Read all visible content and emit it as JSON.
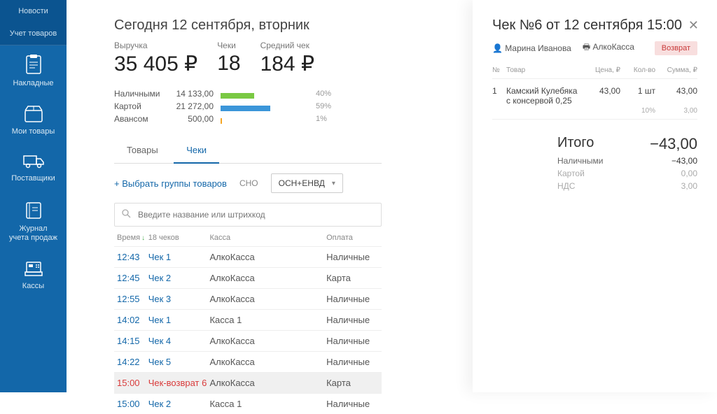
{
  "sidebar": {
    "top_links": [
      "Новости",
      "Учет товаров"
    ],
    "items": [
      {
        "label": "Накладные"
      },
      {
        "label": "Мои товары"
      },
      {
        "label": "Поставщики"
      },
      {
        "label": "Журнал\nучета продаж"
      },
      {
        "label": "Кассы"
      }
    ]
  },
  "date_title": "Сегодня 12 сентября, вторник",
  "metrics": {
    "revenue": {
      "label": "Выручка",
      "value": "35 405 ₽"
    },
    "checks": {
      "label": "Чеки",
      "value": "18"
    },
    "avg": {
      "label": "Средний чек",
      "value": "184 ₽"
    }
  },
  "payments": [
    {
      "label": "Наличными",
      "amount": "14 133,00",
      "pct": "40%",
      "color": "#7ac943",
      "width": 40
    },
    {
      "label": "Картой",
      "amount": "21 272,00",
      "pct": "59%",
      "color": "#3b96d9",
      "width": 59
    },
    {
      "label": "Авансом",
      "amount": "500,00",
      "pct": "1%",
      "color": "#f5a623",
      "width": 2
    }
  ],
  "tabs": {
    "products": "Товары",
    "checks": "Чеки"
  },
  "controls": {
    "group_btn": "Выбрать группы товаров",
    "sno_label": "СНО",
    "sno_value": "ОСН+ЕНВД"
  },
  "search_placeholder": "Введите название или штрихкод",
  "table": {
    "headers": {
      "time": "Время",
      "check": "18 чеков",
      "kassa": "Касса",
      "pay": "Оплата"
    },
    "rows": [
      {
        "time": "12:43",
        "check": "Чек 1",
        "kassa": "АлкоКасса",
        "pay": "Наличные"
      },
      {
        "time": "12:45",
        "check": "Чек 2",
        "kassa": "АлкоКасса",
        "pay": "Карта"
      },
      {
        "time": "12:55",
        "check": "Чек 3",
        "kassa": "АлкоКасса",
        "pay": "Наличные"
      },
      {
        "time": "14:02",
        "check": "Чек 1",
        "kassa": "Касса 1",
        "pay": "Наличные"
      },
      {
        "time": "14:15",
        "check": "Чек 4",
        "kassa": "АлкоКасса",
        "pay": "Наличные"
      },
      {
        "time": "14:22",
        "check": "Чек 5",
        "kassa": "АлкоКасса",
        "pay": "Наличные"
      },
      {
        "time": "15:00",
        "check": "Чек-возврат 6",
        "kassa": "АлкоКасса",
        "pay": "Карта",
        "selected": true
      },
      {
        "time": "15:00",
        "check": "Чек 2",
        "kassa": "Касса 1",
        "pay": "Наличные"
      }
    ]
  },
  "detail": {
    "title": "Чек №6 от 12 сентября 15:00",
    "cashier": "Марина Иванова",
    "kassa": "АлкоКасса",
    "badge": "Возврат",
    "item_headers": {
      "num": "№",
      "name": "Товар",
      "price": "Цена, ₽",
      "qty": "Кол-во",
      "sum": "Сумма, ₽"
    },
    "items": [
      {
        "num": "1",
        "name": "Камский Кулебяка с консервой 0,25",
        "price": "43,00",
        "qty": "1 шт",
        "sum": "43,00",
        "tax_label": "10%",
        "tax_val": "3,00"
      }
    ],
    "totals": {
      "main_label": "Итого",
      "main_value": "−43,00",
      "cash_label": "Наличными",
      "cash_value": "−43,00",
      "card_label": "Картой",
      "card_value": "0,00",
      "nds_label": "НДС",
      "nds_value": "3,00"
    }
  }
}
